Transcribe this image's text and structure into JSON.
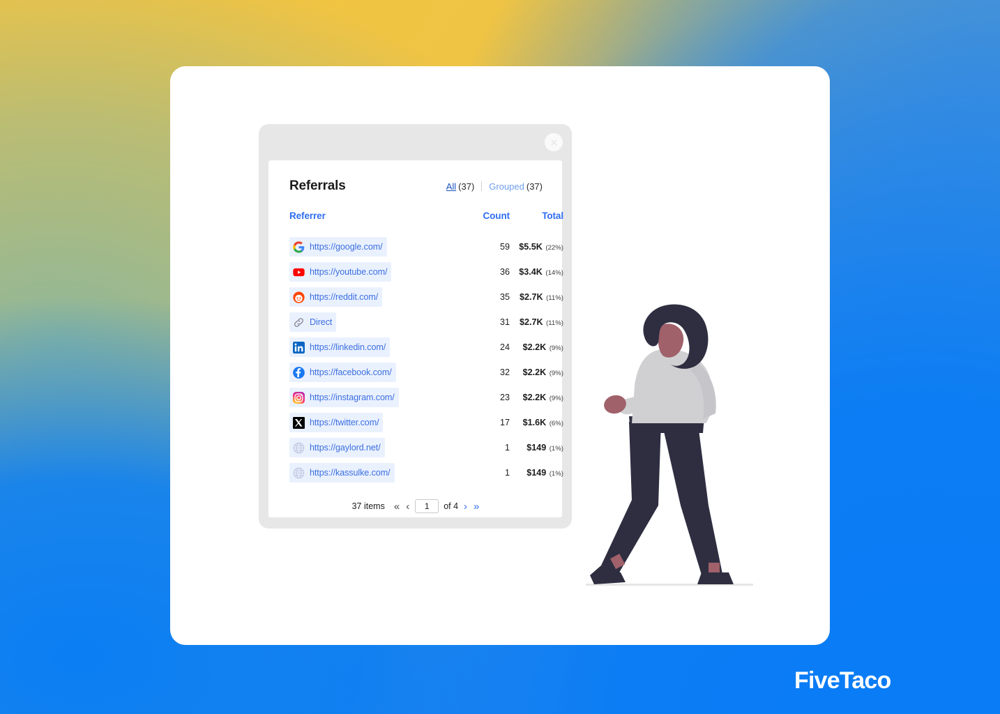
{
  "background": {
    "gradient_colors": [
      "#edc044",
      "#93b692",
      "#4a93de",
      "#0b7ef4"
    ]
  },
  "brand": {
    "name": "FiveTaco"
  },
  "dialog": {
    "title": "Referrals",
    "close_icon": "close-icon",
    "view_toggle": {
      "all_label": "All",
      "all_count": "(37)",
      "grouped_label": "Grouped",
      "grouped_count": "(37)",
      "active": "All"
    },
    "columns": {
      "referrer": "Referrer",
      "count": "Count",
      "total": "Total"
    },
    "rows": [
      {
        "icon": "google-favicon",
        "referrer": "https://google.com/",
        "count": "59",
        "total": "$5.5K",
        "pct": "(22%)"
      },
      {
        "icon": "youtube-favicon",
        "referrer": "https://youtube.com/",
        "count": "36",
        "total": "$3.4K",
        "pct": "(14%)"
      },
      {
        "icon": "reddit-favicon",
        "referrer": "https://reddit.com/",
        "count": "35",
        "total": "$2.7K",
        "pct": "(11%)"
      },
      {
        "icon": "link-icon",
        "referrer": "Direct",
        "count": "31",
        "total": "$2.7K",
        "pct": "(11%)"
      },
      {
        "icon": "linkedin-favicon",
        "referrer": "https://linkedin.com/",
        "count": "24",
        "total": "$2.2K",
        "pct": "(9%)"
      },
      {
        "icon": "facebook-favicon",
        "referrer": "https://facebook.com/",
        "count": "32",
        "total": "$2.2K",
        "pct": "(9%)"
      },
      {
        "icon": "instagram-favicon",
        "referrer": "https://instagram.com/",
        "count": "23",
        "total": "$2.2K",
        "pct": "(9%)"
      },
      {
        "icon": "twitter-x-favicon",
        "referrer": "https://twitter.com/",
        "count": "17",
        "total": "$1.6K",
        "pct": "(6%)"
      },
      {
        "icon": "globe-favicon",
        "referrer": "https://gaylord.net/",
        "count": "1",
        "total": "$149",
        "pct": "(1%)"
      },
      {
        "icon": "globe-favicon",
        "referrer": "https://kassulke.com/",
        "count": "1",
        "total": "$149",
        "pct": "(1%)"
      }
    ],
    "pagination": {
      "items_label": "37 items",
      "first_icon": "«",
      "prev_icon": "‹",
      "page_value": "1",
      "of_label": "of 4",
      "next_icon": "›",
      "last_icon": "»"
    }
  },
  "illustration": {
    "name": "walking-person-illustration",
    "colors": {
      "hair": "#2f2e41",
      "shirt": "#d0d0d3",
      "pants": "#2f2e41",
      "skin": "#a0616a",
      "ground": "#e6e6e6"
    }
  }
}
